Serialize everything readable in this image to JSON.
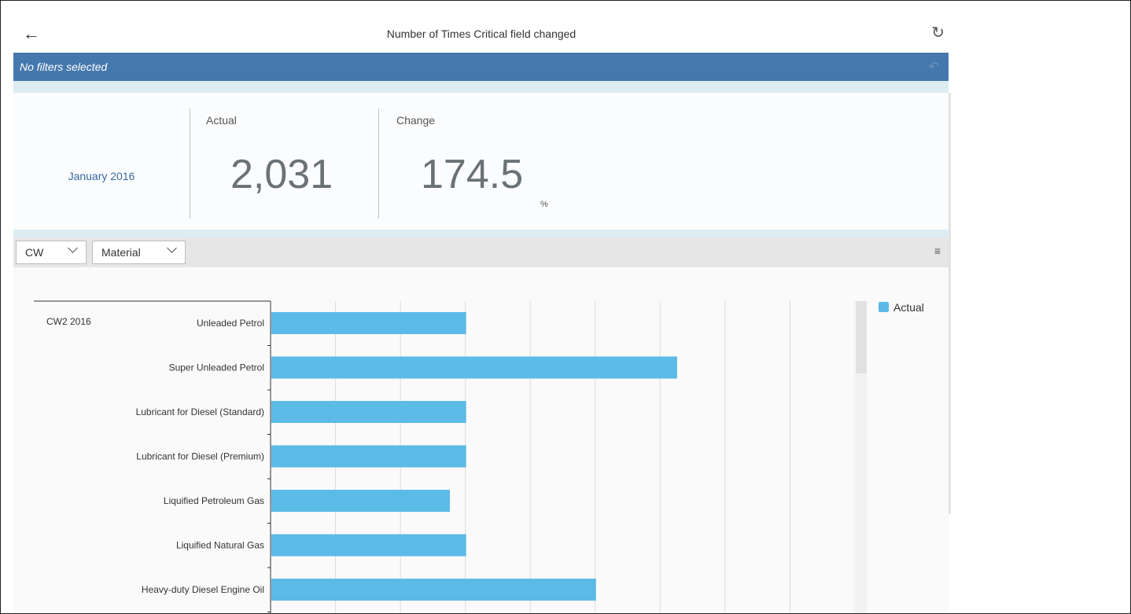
{
  "header": {
    "back_icon": "arrow-left-icon",
    "title": "Number of Times Critical field changed",
    "refresh_icon": "refresh-icon"
  },
  "filter_bar": {
    "text": "No filters selected",
    "undo_icon": "undo-icon",
    "color": "#4578ad"
  },
  "kpi": {
    "period": "January 2016",
    "actual": {
      "label": "Actual",
      "value": "2,031"
    },
    "change": {
      "label": "Change",
      "value": "174.5",
      "unit": "%"
    }
  },
  "toolbar": {
    "dropdowns": [
      {
        "label": "CW"
      },
      {
        "label": "Material"
      }
    ],
    "chart_icon": "bar-chart-icon"
  },
  "legend": {
    "label": "Actual",
    "color": "#5cbae6"
  },
  "chart_data": {
    "type": "bar",
    "orientation": "horizontal",
    "group_label": "CW2 2016",
    "categories": [
      "Unleaded Petrol",
      "Super Unleaded Petrol",
      "Lubricant for Diesel (Standard)",
      "Lubricant for Diesel (Premium)",
      "Liquified Petroleum Gas",
      "Liquified Natural Gas",
      "Heavy-duty Diesel Engine Oil"
    ],
    "series": [
      {
        "name": "Actual",
        "values": [
          3,
          6.25,
          3,
          3,
          2.75,
          3,
          5
        ]
      }
    ],
    "xlim": [
      0,
      9
    ],
    "grid": true,
    "legend_position": "right"
  }
}
